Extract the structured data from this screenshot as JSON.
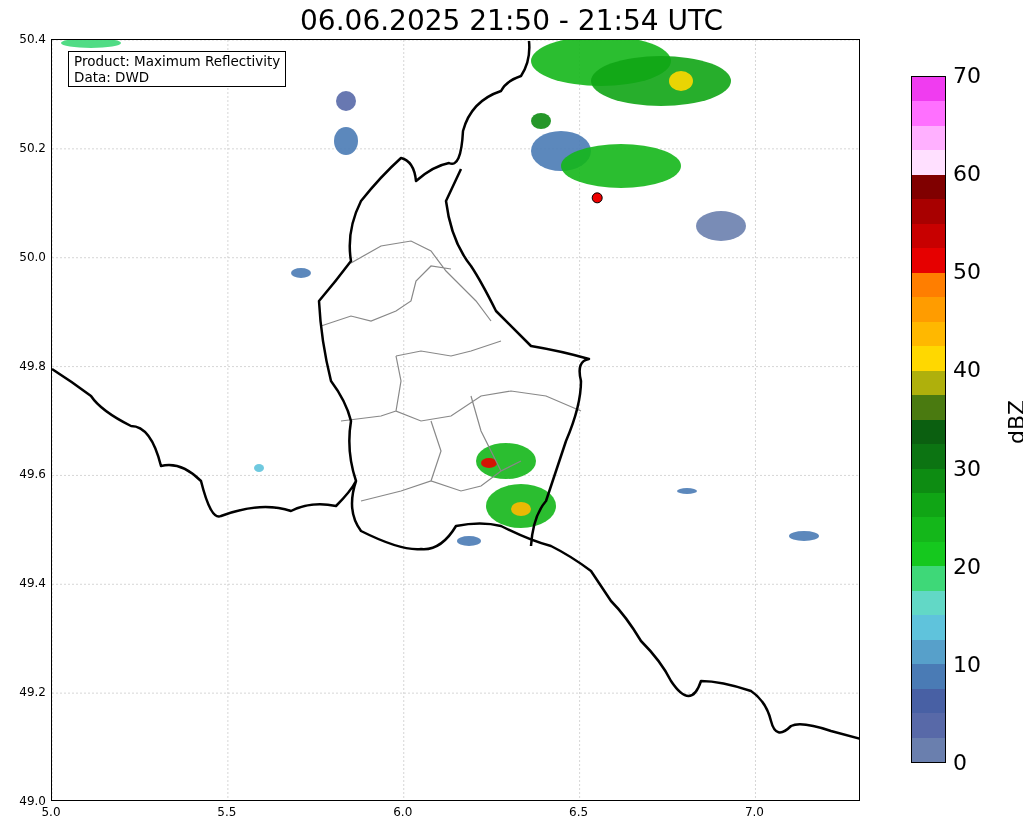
{
  "title": "06.06.2025 21:50 - 21:54 UTC",
  "legend": [
    "Product: Maximum Reflectivity",
    "Data: DWD"
  ],
  "x_ticks": [
    "5.0",
    "5.5",
    "6.0",
    "6.5",
    "7.0"
  ],
  "y_ticks": [
    "50.4",
    "50.2",
    "50.0",
    "49.8",
    "49.6",
    "49.4",
    "49.2",
    "49.0"
  ],
  "colorbar": {
    "label": "dBZ",
    "ticks": [
      "70",
      "60",
      "50",
      "40",
      "30",
      "20",
      "10",
      "0"
    ],
    "bands": [
      {
        "color": "#f03cf0"
      },
      {
        "color": "#ff70ff"
      },
      {
        "color": "#ffb0ff"
      },
      {
        "color": "#ffe0ff"
      },
      {
        "color": "#800000"
      },
      {
        "color": "#a80000"
      },
      {
        "color": "#c80000"
      },
      {
        "color": "#e60000"
      },
      {
        "color": "#ff7e00"
      },
      {
        "color": "#ff9c00"
      },
      {
        "color": "#ffb800"
      },
      {
        "color": "#ffd800"
      },
      {
        "color": "#afb00c"
      },
      {
        "color": "#4a7a10"
      },
      {
        "color": "#0b5f10"
      },
      {
        "color": "#0c7412"
      },
      {
        "color": "#0d8c12"
      },
      {
        "color": "#10a515"
      },
      {
        "color": "#14b71a"
      },
      {
        "color": "#15c81e"
      },
      {
        "color": "#3ed878"
      },
      {
        "color": "#62d8c6"
      },
      {
        "color": "#5fc3dc"
      },
      {
        "color": "#57a0ca"
      },
      {
        "color": "#4a7bb5"
      },
      {
        "color": "#4860a4"
      },
      {
        "color": "#5869a8"
      },
      {
        "color": "#6a7fae"
      }
    ]
  }
}
